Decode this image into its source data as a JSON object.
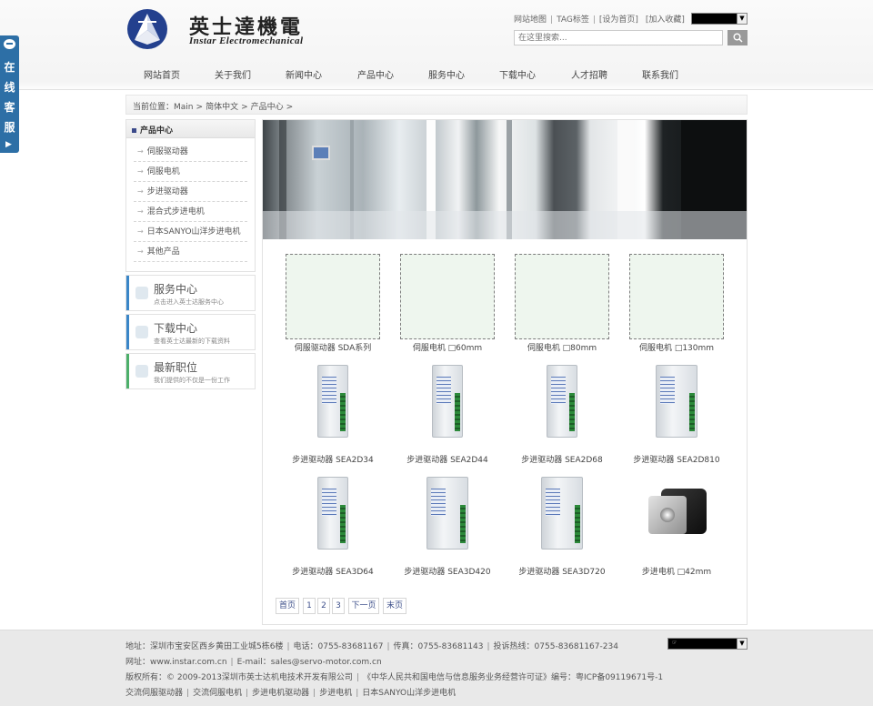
{
  "header": {
    "logo_name": "英士達機電",
    "logo_sub": "Instar Electromechanical",
    "toplinks": [
      "网站地图",
      "TAG标签",
      "[设为首页]",
      "[加入收藏]"
    ],
    "search_placeholder": "在这里搜索...",
    "search_icon": "search-icon",
    "language_select_value": ""
  },
  "nav": {
    "items": [
      "网站首页",
      "关于我们",
      "新闻中心",
      "产品中心",
      "服务中心",
      "下载中心",
      "人才招聘",
      "联系我们"
    ]
  },
  "breadcrumb": {
    "prefix": "当前位置：",
    "items": [
      "Main",
      "简体中文",
      "产品中心"
    ],
    "separator": ">"
  },
  "sidebar": {
    "title": "产品中心",
    "items": [
      "伺服驱动器",
      "伺服电机",
      "步进驱动器",
      "混合式步进电机",
      "日本SANYO山洋步进电机",
      "其他产品"
    ],
    "promos": [
      {
        "title": "服务中心",
        "sub": "点击进入英士达服务中心",
        "color": "#3a86c8"
      },
      {
        "title": "下载中心",
        "sub": "查看英士达最新的下载资料",
        "color": "#3a86c8"
      },
      {
        "title": "最新职位",
        "sub": "我们提供的不仅是一份工作",
        "color": "#4caf6a"
      }
    ]
  },
  "products": [
    {
      "name": "伺服驱动器 SDA系列",
      "kind": "placeholder"
    },
    {
      "name": "伺服电机 □60mm",
      "kind": "placeholder"
    },
    {
      "name": "伺服电机 □80mm",
      "kind": "placeholder"
    },
    {
      "name": "伺服电机 □130mm",
      "kind": "placeholder"
    },
    {
      "name": "步进驱动器 SEA2D34",
      "kind": "driver"
    },
    {
      "name": "步进驱动器 SEA2D44",
      "kind": "driver"
    },
    {
      "name": "步进驱动器 SEA2D68",
      "kind": "driver"
    },
    {
      "name": "步进驱动器 SEA2D810",
      "kind": "driver-big"
    },
    {
      "name": "步进驱动器 SEA3D64",
      "kind": "driver"
    },
    {
      "name": "步进驱动器 SEA3D420",
      "kind": "driver-big"
    },
    {
      "name": "步进驱动器 SEA3D720",
      "kind": "driver-big"
    },
    {
      "name": "步进电机 □42mm",
      "kind": "motor"
    }
  ],
  "pagination": [
    "首页",
    "1",
    "2",
    "3",
    "下一页",
    "末页"
  ],
  "chat": {
    "label": "在线客服",
    "icon": "chat-bubble-icon",
    "arrow": "▶"
  },
  "footer": {
    "line1": [
      "地址：深圳市宝安区西乡黄田工业城5栋6楼",
      "电话：0755-83681167",
      "传真：0755-83681143",
      "投诉热线：0755-83681167-234"
    ],
    "line2": [
      "网址：www.instar.com.cn",
      "E-mail：sales@servo-motor.com.cn"
    ],
    "line3": [
      "版权所有：© 2009-2013深圳市英士达机电技术开发有限公司",
      "《中华人民共和国电信与信息服务业务经营许可证》编号：粤ICP备09119671号-1"
    ],
    "line4": [
      "交流伺服驱动器",
      "交流伺服电机",
      "步进电机驱动器",
      "步进电机",
      "日本SANYO山洋步进电机"
    ],
    "language_select_value": "☞"
  }
}
